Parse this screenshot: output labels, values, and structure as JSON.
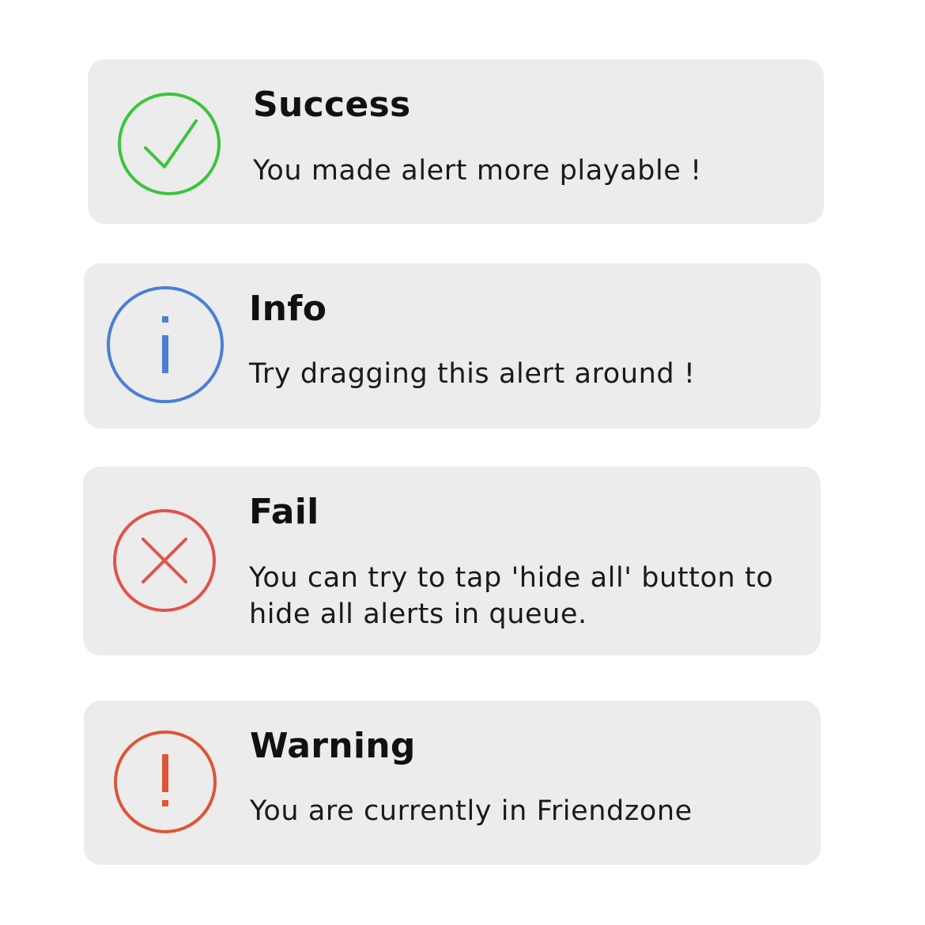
{
  "alerts": [
    {
      "type": "success",
      "icon": "checkmark-circle-icon",
      "color": "#3cc43c",
      "title": "Success",
      "message": "You made alert more playable !"
    },
    {
      "type": "info",
      "icon": "info-circle-icon",
      "color": "#4a7fd4",
      "title": "Info",
      "message": "Try dragging this alert around !"
    },
    {
      "type": "fail",
      "icon": "x-circle-icon",
      "color": "#e2524a",
      "title": "Fail",
      "message": "You can try to tap 'hide all' button to hide all alerts in queue."
    },
    {
      "type": "warning",
      "icon": "exclamation-circle-icon",
      "color": "#dd5535",
      "title": "Warning",
      "message": "You are currently in Friendzone"
    }
  ]
}
